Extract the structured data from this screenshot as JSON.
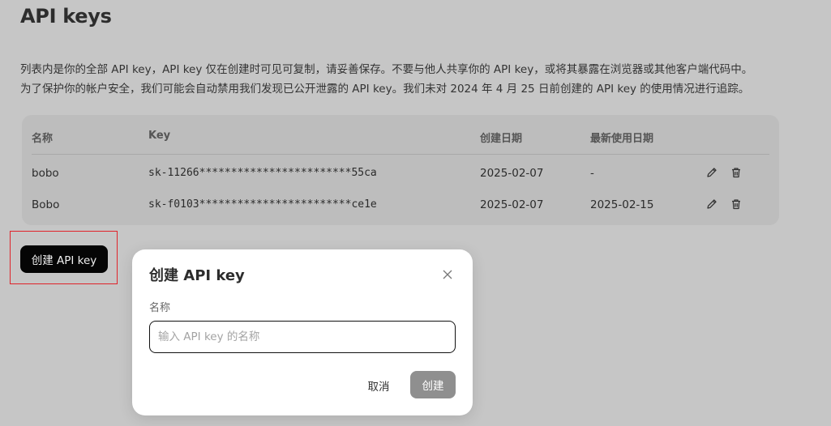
{
  "page": {
    "title": "API keys",
    "description": [
      "列表内是你的全部 API key，API key 仅在创建时可见可复制，请妥善保存。不要与他人共享你的 API key，或将其暴露在浏览器或其他客户端代码中。",
      "为了保护你的帐户安全，我们可能会自动禁用我们发现已公开泄露的 API key。我们未对 2024 年 4 月 25 日前创建的 API key 的使用情况进行追踪。"
    ]
  },
  "table": {
    "headers": {
      "name": "名称",
      "key": "Key",
      "created": "创建日期",
      "last_used": "最新使用日期"
    },
    "rows": [
      {
        "name": "bobo",
        "key": "sk-11266************************55ca",
        "created": "2025-02-07",
        "last_used": "-"
      },
      {
        "name": "Bobo",
        "key": "sk-f0103************************ce1e",
        "created": "2025-02-07",
        "last_used": "2025-02-15"
      }
    ],
    "icons": {
      "edit": "pencil-icon",
      "delete": "trash-icon"
    }
  },
  "create_button": {
    "label": "创建 API key"
  },
  "modal": {
    "title": "创建 API key",
    "field_label": "名称",
    "input_value": "",
    "input_placeholder": "输入 API key 的名称",
    "cancel_label": "取消",
    "submit_label": "创建",
    "close_icon": "close-icon"
  },
  "colors": {
    "background": "#c6c6c6",
    "primary_button": "#050505",
    "submit_disabled": "#8f8f8f",
    "highlight": "#e0232a"
  }
}
